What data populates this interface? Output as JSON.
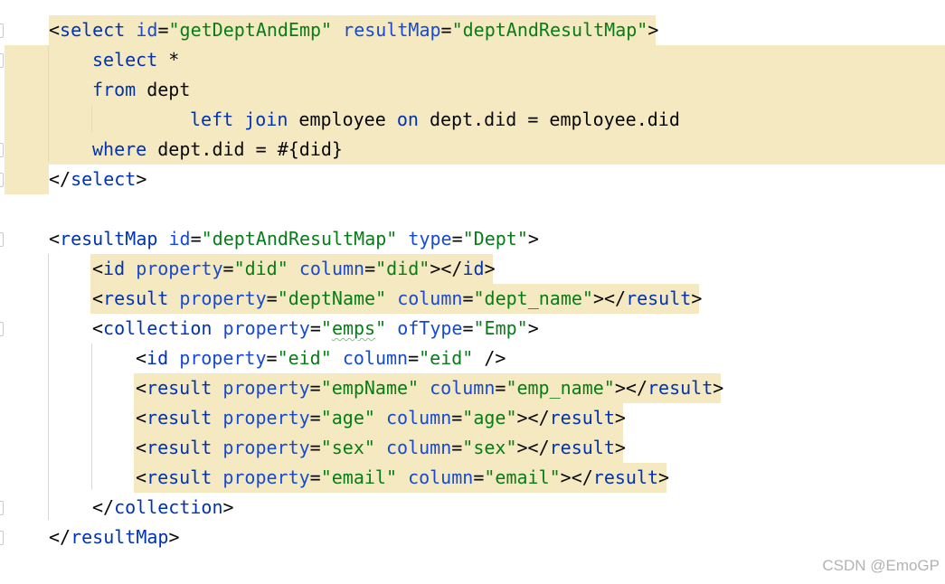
{
  "editor": {
    "lines": [
      {
        "tokens": [
          {
            "c": "b",
            "t": "<"
          },
          {
            "c": "k",
            "t": "select"
          },
          {
            "c": "b",
            "t": " "
          },
          {
            "c": "a",
            "t": "id"
          },
          {
            "c": "b",
            "t": "="
          },
          {
            "c": "s",
            "t": "\"getDeptAndEmp\""
          },
          {
            "c": "b",
            "t": " "
          },
          {
            "c": "a",
            "t": "resultMap"
          },
          {
            "c": "b",
            "t": "="
          },
          {
            "c": "s",
            "t": "\"deptAndResultMap\""
          },
          {
            "c": "b",
            "t": ">"
          }
        ]
      },
      {
        "tokens": [
          {
            "c": "k",
            "t": "select"
          },
          {
            "c": "b",
            "t": " *"
          }
        ]
      },
      {
        "tokens": [
          {
            "c": "k",
            "t": "from"
          },
          {
            "c": "b",
            "t": " dept"
          }
        ]
      },
      {
        "tokens": [
          {
            "c": "k",
            "t": "left"
          },
          {
            "c": "b",
            "t": " "
          },
          {
            "c": "k",
            "t": "join"
          },
          {
            "c": "b",
            "t": " employee "
          },
          {
            "c": "k",
            "t": "on"
          },
          {
            "c": "b",
            "t": " dept.did = employee.did"
          }
        ]
      },
      {
        "tokens": [
          {
            "c": "k",
            "t": "where"
          },
          {
            "c": "b",
            "t": " dept.did = #{did}"
          }
        ]
      },
      {
        "tokens": [
          {
            "c": "b",
            "t": "</"
          },
          {
            "c": "k",
            "t": "select"
          },
          {
            "c": "b",
            "t": ">"
          }
        ]
      },
      {
        "tokens": []
      },
      {
        "tokens": [
          {
            "c": "b",
            "t": "<"
          },
          {
            "c": "k",
            "t": "resultMap"
          },
          {
            "c": "b",
            "t": " "
          },
          {
            "c": "a",
            "t": "id"
          },
          {
            "c": "b",
            "t": "="
          },
          {
            "c": "s",
            "t": "\"deptAndResultMap\""
          },
          {
            "c": "b",
            "t": " "
          },
          {
            "c": "a",
            "t": "type"
          },
          {
            "c": "b",
            "t": "="
          },
          {
            "c": "s",
            "t": "\"Dept\""
          },
          {
            "c": "b",
            "t": ">"
          }
        ]
      },
      {
        "tokens": [
          {
            "c": "b",
            "t": "<"
          },
          {
            "c": "k",
            "t": "id"
          },
          {
            "c": "b",
            "t": " "
          },
          {
            "c": "a",
            "t": "property"
          },
          {
            "c": "b",
            "t": "="
          },
          {
            "c": "s",
            "t": "\"did\""
          },
          {
            "c": "b",
            "t": " "
          },
          {
            "c": "a",
            "t": "column"
          },
          {
            "c": "b",
            "t": "="
          },
          {
            "c": "s",
            "t": "\"did\""
          },
          {
            "c": "b",
            "t": "></"
          },
          {
            "c": "k",
            "t": "id"
          },
          {
            "c": "b",
            "t": ">"
          }
        ]
      },
      {
        "tokens": [
          {
            "c": "b",
            "t": "<"
          },
          {
            "c": "k",
            "t": "result"
          },
          {
            "c": "b",
            "t": " "
          },
          {
            "c": "a",
            "t": "property"
          },
          {
            "c": "b",
            "t": "="
          },
          {
            "c": "s",
            "t": "\"deptName\""
          },
          {
            "c": "b",
            "t": " "
          },
          {
            "c": "a",
            "t": "column"
          },
          {
            "c": "b",
            "t": "="
          },
          {
            "c": "s",
            "t": "\"dept_name\""
          },
          {
            "c": "b",
            "t": "></"
          },
          {
            "c": "k",
            "t": "result"
          },
          {
            "c": "b",
            "t": ">"
          }
        ]
      },
      {
        "tokens": [
          {
            "c": "b",
            "t": "<"
          },
          {
            "c": "k",
            "t": "collection"
          },
          {
            "c": "b",
            "t": " "
          },
          {
            "c": "a",
            "t": "property"
          },
          {
            "c": "b",
            "t": "="
          },
          {
            "c": "s",
            "t": "\""
          },
          {
            "c": "s emps",
            "t": "emps"
          },
          {
            "c": "s",
            "t": "\""
          },
          {
            "c": "b",
            "t": " "
          },
          {
            "c": "a",
            "t": "ofType"
          },
          {
            "c": "b",
            "t": "="
          },
          {
            "c": "s",
            "t": "\"Emp\""
          },
          {
            "c": "b",
            "t": ">"
          }
        ]
      },
      {
        "tokens": [
          {
            "c": "b",
            "t": "<"
          },
          {
            "c": "k",
            "t": "id"
          },
          {
            "c": "b",
            "t": " "
          },
          {
            "c": "a",
            "t": "property"
          },
          {
            "c": "b",
            "t": "="
          },
          {
            "c": "s",
            "t": "\"eid\""
          },
          {
            "c": "b",
            "t": " "
          },
          {
            "c": "a",
            "t": "column"
          },
          {
            "c": "b",
            "t": "="
          },
          {
            "c": "s",
            "t": "\"eid\""
          },
          {
            "c": "b",
            "t": " />"
          }
        ]
      },
      {
        "tokens": [
          {
            "c": "b",
            "t": "<"
          },
          {
            "c": "k",
            "t": "result"
          },
          {
            "c": "b",
            "t": " "
          },
          {
            "c": "a",
            "t": "property"
          },
          {
            "c": "b",
            "t": "="
          },
          {
            "c": "s",
            "t": "\"empName\""
          },
          {
            "c": "b",
            "t": " "
          },
          {
            "c": "a",
            "t": "column"
          },
          {
            "c": "b",
            "t": "="
          },
          {
            "c": "s",
            "t": "\"emp_name\""
          },
          {
            "c": "b",
            "t": "></"
          },
          {
            "c": "k",
            "t": "result"
          },
          {
            "c": "b",
            "t": ">"
          }
        ]
      },
      {
        "tokens": [
          {
            "c": "b",
            "t": "<"
          },
          {
            "c": "k",
            "t": "result"
          },
          {
            "c": "b",
            "t": " "
          },
          {
            "c": "a",
            "t": "property"
          },
          {
            "c": "b",
            "t": "="
          },
          {
            "c": "s",
            "t": "\"age\""
          },
          {
            "c": "b",
            "t": " "
          },
          {
            "c": "a",
            "t": "column"
          },
          {
            "c": "b",
            "t": "="
          },
          {
            "c": "s",
            "t": "\"age\""
          },
          {
            "c": "b",
            "t": "></"
          },
          {
            "c": "k",
            "t": "result"
          },
          {
            "c": "b",
            "t": ">"
          }
        ]
      },
      {
        "tokens": [
          {
            "c": "b",
            "t": "<"
          },
          {
            "c": "k",
            "t": "result"
          },
          {
            "c": "b",
            "t": " "
          },
          {
            "c": "a",
            "t": "property"
          },
          {
            "c": "b",
            "t": "="
          },
          {
            "c": "s",
            "t": "\"sex\""
          },
          {
            "c": "b",
            "t": " "
          },
          {
            "c": "a",
            "t": "column"
          },
          {
            "c": "b",
            "t": "="
          },
          {
            "c": "s",
            "t": "\"sex\""
          },
          {
            "c": "b",
            "t": "></"
          },
          {
            "c": "k",
            "t": "result"
          },
          {
            "c": "b",
            "t": ">"
          }
        ]
      },
      {
        "tokens": [
          {
            "c": "b",
            "t": "<"
          },
          {
            "c": "k",
            "t": "result"
          },
          {
            "c": "b",
            "t": " "
          },
          {
            "c": "a",
            "t": "property"
          },
          {
            "c": "b",
            "t": "="
          },
          {
            "c": "s",
            "t": "\"email\""
          },
          {
            "c": "b",
            "t": " "
          },
          {
            "c": "a",
            "t": "column"
          },
          {
            "c": "b",
            "t": "="
          },
          {
            "c": "s",
            "t": "\"email\""
          },
          {
            "c": "b",
            "t": "></"
          },
          {
            "c": "k",
            "t": "result"
          },
          {
            "c": "b",
            "t": ">"
          }
        ]
      },
      {
        "tokens": [
          {
            "c": "b",
            "t": "</"
          },
          {
            "c": "k",
            "t": "collection"
          },
          {
            "c": "b",
            "t": ">"
          }
        ]
      },
      {
        "tokens": [
          {
            "c": "b",
            "t": "</"
          },
          {
            "c": "k",
            "t": "resultMap"
          },
          {
            "c": "b",
            "t": ">"
          }
        ]
      }
    ]
  },
  "watermark": "CSDN @EmoGP",
  "colors": {
    "tag_keyword": "#0033b3",
    "attribute": "#174ad4",
    "string": "#067d17",
    "text": "#080808",
    "highlight": "#f5e9c1",
    "background": "#ffffff"
  }
}
